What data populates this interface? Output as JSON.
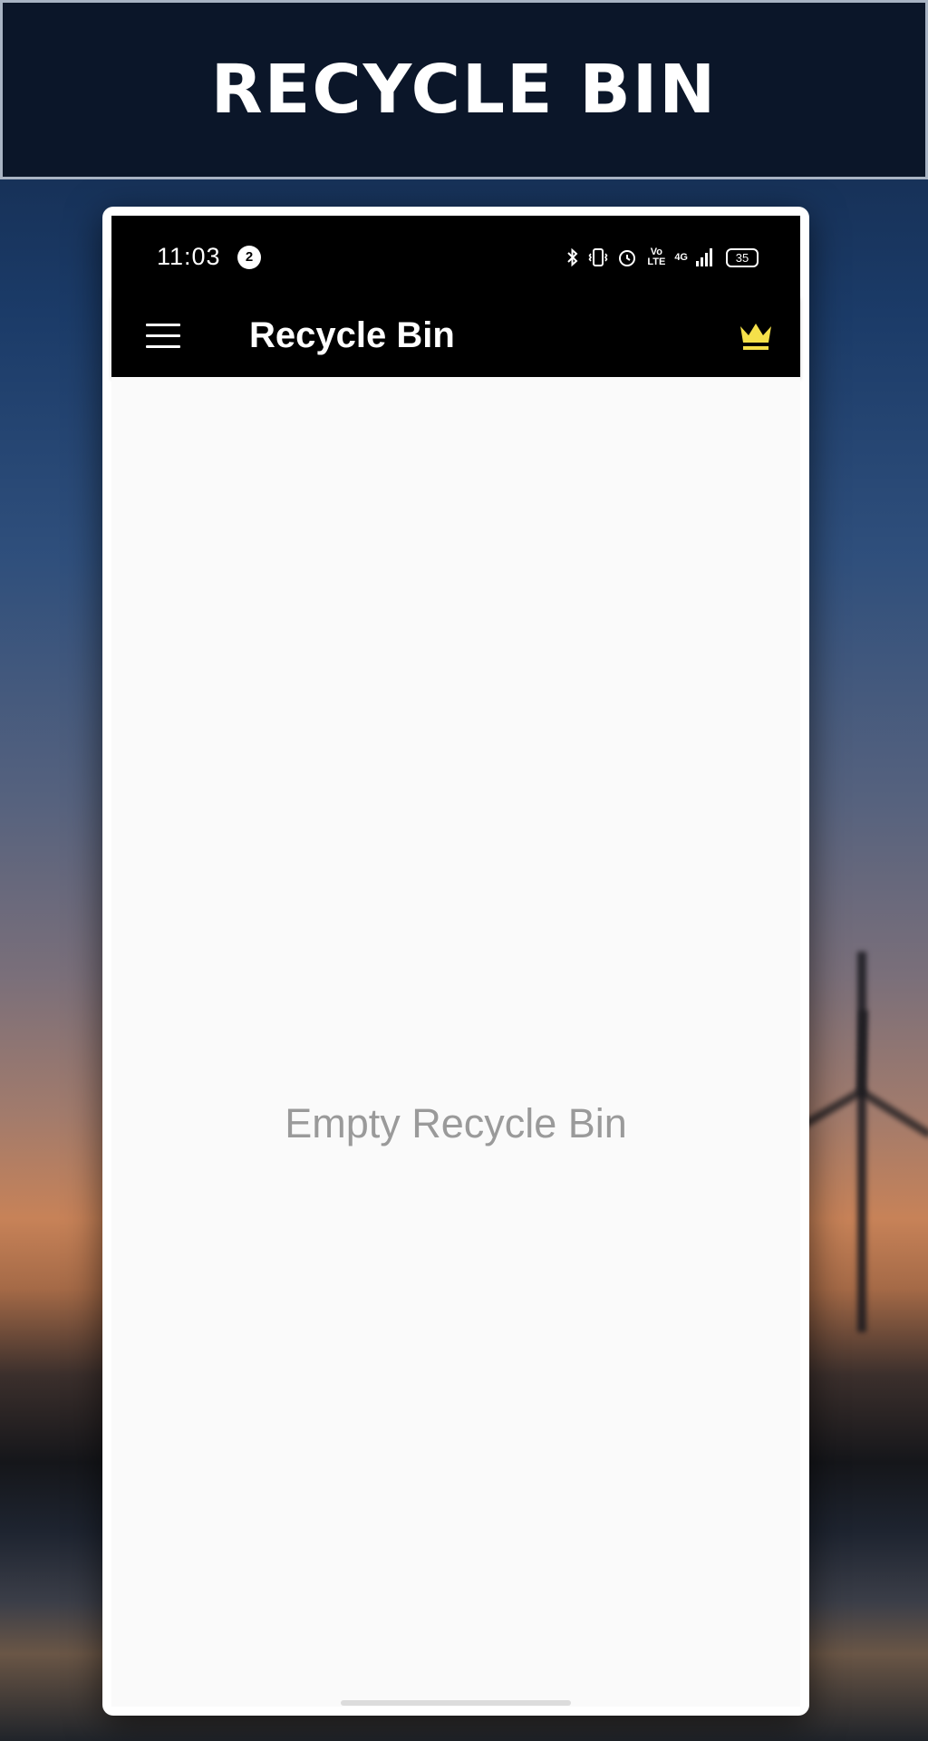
{
  "banner": {
    "title": "RECYCLE BIN"
  },
  "status_bar": {
    "time": "11:03",
    "notification_count": "2",
    "volte_line1": "Vo",
    "volte_line2": "LTE",
    "network": "4G",
    "battery_level": "35",
    "icons": [
      "bluetooth-icon",
      "vibrate-icon",
      "alarm-icon",
      "volte-icon",
      "signal-icon",
      "battery-icon"
    ]
  },
  "app_bar": {
    "title": "Recycle Bin",
    "menu_icon": "hamburger-menu-icon",
    "premium_icon": "crown-icon",
    "premium_color": "#f5e04a"
  },
  "content": {
    "empty_message": "Empty Recycle Bin"
  }
}
